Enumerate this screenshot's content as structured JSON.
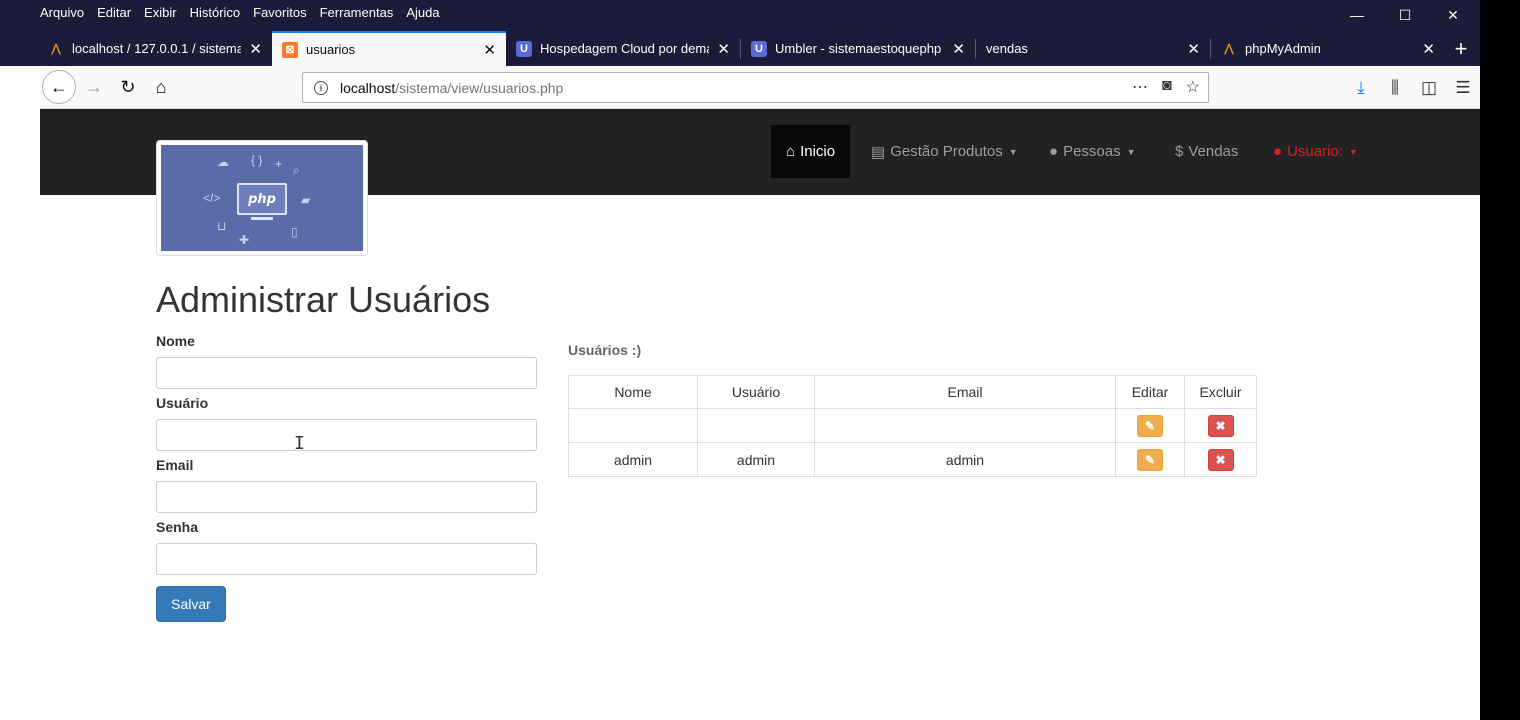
{
  "browser": {
    "menu": [
      "Arquivo",
      "Editar",
      "Exibir",
      "Histórico",
      "Favoritos",
      "Ferramentas",
      "Ajuda"
    ],
    "window_controls": {
      "minimize": "—",
      "maximize": "☐",
      "close": "✕"
    },
    "tabs": [
      {
        "label": "localhost / 127.0.0.1 / sistema",
        "favicon": "phpmyadmin-icon"
      },
      {
        "label": "usuarios",
        "favicon": "xampp-icon",
        "active": true
      },
      {
        "label": "Hospedagem Cloud por demanda",
        "favicon": "umbler-icon"
      },
      {
        "label": "Umbler - sistemaestoquephp",
        "favicon": "umbler-icon"
      },
      {
        "label": "vendas",
        "favicon": ""
      },
      {
        "label": "phpMyAdmin",
        "favicon": "phpmyadmin-icon"
      }
    ],
    "new_tab": "+",
    "url_host": "localhost",
    "url_path": "/sistema/view/usuarios.php"
  },
  "site_nav": {
    "inicio": "Inicio",
    "gestao_produtos": "Gestão Produtos",
    "pessoas": "Pessoas",
    "vendas": "Vendas",
    "usuario": "Usuario:"
  },
  "logo_text": "php",
  "page": {
    "title": "Administrar Usuários",
    "form": {
      "nome_label": "Nome",
      "usuario_label": "Usuário",
      "email_label": "Email",
      "senha_label": "Senha",
      "save_label": "Salvar"
    },
    "table_caption": "Usuários :)",
    "table_headers": {
      "nome": "Nome",
      "usuario": "Usuário",
      "email": "Email",
      "editar": "Editar",
      "excluir": "Excluir"
    },
    "rows": [
      {
        "nome": "",
        "usuario": "",
        "email": ""
      },
      {
        "nome": "admin",
        "usuario": "admin",
        "email": "admin"
      }
    ]
  },
  "colors": {
    "primary": "#337ab7",
    "warning": "#f0ad4e",
    "danger": "#d9534f",
    "navbar": "#222222",
    "user_red": "#e02020"
  }
}
